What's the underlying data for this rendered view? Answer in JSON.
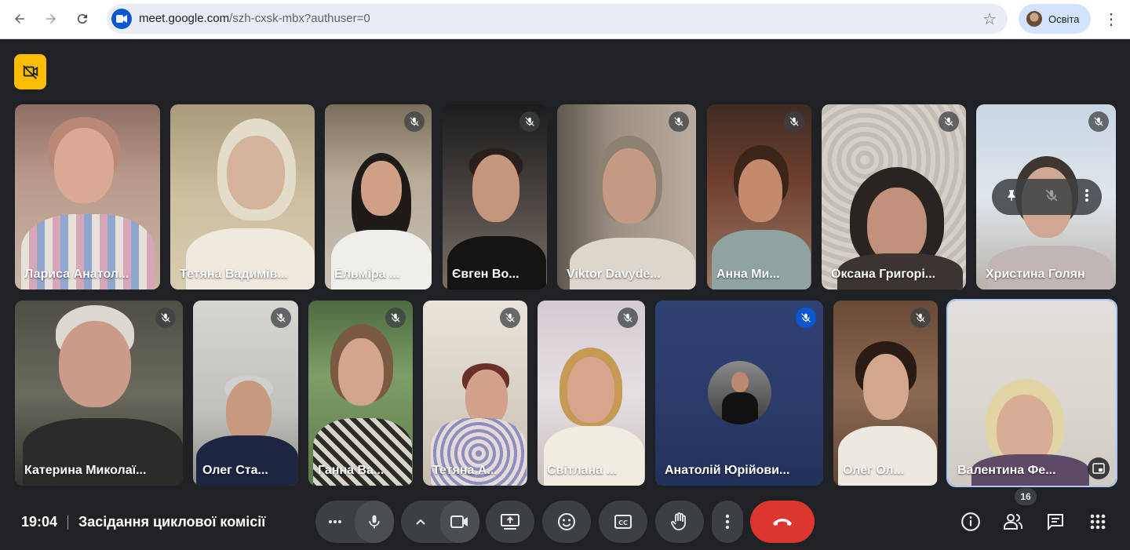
{
  "browser": {
    "back_icon": "arrow-left-icon",
    "forward_icon": "arrow-right-icon",
    "reload_icon": "reload-icon",
    "url_host": "meet.google.com",
    "url_path": "/szh-cxsk-mbx?authuser=0",
    "profile_label": "Освіта"
  },
  "participants_row1": [
    {
      "name": "Лариса Анатол...",
      "muted": false
    },
    {
      "name": "Тетяна Вадимів...",
      "muted": false
    },
    {
      "name": "Ельміра ...",
      "muted": true
    },
    {
      "name": "Євген Во...",
      "muted": true
    },
    {
      "name": "Viktor Davyde...",
      "muted": true
    },
    {
      "name": "Анна Ми...",
      "muted": true
    },
    {
      "name": "Оксана Григорі...",
      "muted": true
    },
    {
      "name": "Христина Голян",
      "muted": true
    }
  ],
  "participants_row2": [
    {
      "name": "Катерина Миколаї...",
      "muted": true
    },
    {
      "name": "Олег Ста...",
      "muted": true
    },
    {
      "name": "Ганна Ва...",
      "muted": true
    },
    {
      "name": "Тетяна А...",
      "muted": true
    },
    {
      "name": "Світлана ...",
      "muted": true
    },
    {
      "name": "Анатолій Юрійови...",
      "muted": true
    },
    {
      "name": "Олег Ол...",
      "muted": true
    },
    {
      "name": "Валентина Фе...",
      "muted": false
    }
  ],
  "bottom": {
    "time": "19:04",
    "meeting_title": "Засідання циклової комісії",
    "participant_count": "16"
  },
  "colors": {
    "background": "#202124",
    "control": "#3c4043",
    "end_call": "#dc362e",
    "badge_yellow": "#fbbc04",
    "accent_blue": "#0b57d0"
  }
}
